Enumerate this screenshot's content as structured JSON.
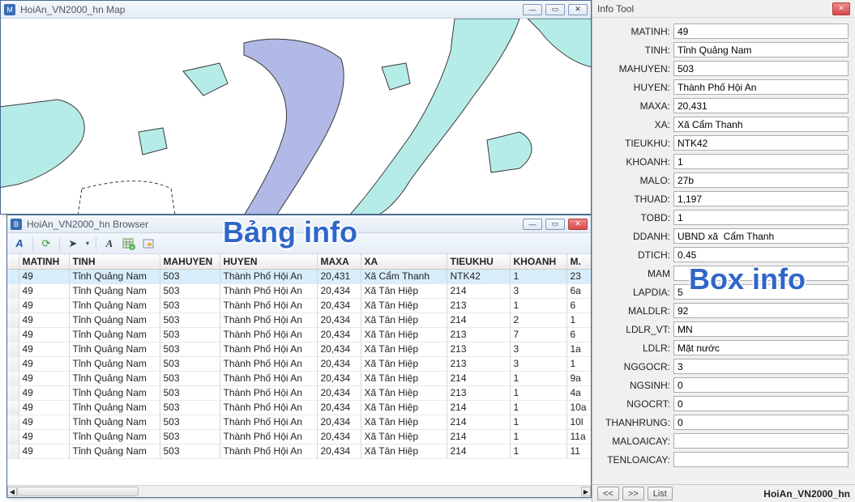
{
  "mapWindow": {
    "title": "HoiAn_VN2000_hn Map"
  },
  "browserWindow": {
    "title": "HoiAn_VN2000_hn Browser",
    "columns": [
      "MATINH",
      "TINH",
      "MAHUYEN",
      "HUYEN",
      "MAXA",
      "XA",
      "TIEUKHU",
      "KHOANH",
      "M."
    ],
    "rows": [
      {
        "sel": true,
        "MATINH": "49",
        "TINH": "Tỉnh Quảng Nam",
        "MAHUYEN": "503",
        "HUYEN": "Thành Phố Hội An",
        "MAXA": "20,431",
        "XA": "Xã Cẩm Thanh",
        "TIEUKHU": "NTK42",
        "KHOANH": "1",
        "M": "23"
      },
      {
        "MATINH": "49",
        "TINH": "Tỉnh Quảng Nam",
        "MAHUYEN": "503",
        "HUYEN": "Thành Phố Hội An",
        "MAXA": "20,434",
        "XA": "Xã Tân Hiệp",
        "TIEUKHU": "214",
        "KHOANH": "3",
        "M": "6a"
      },
      {
        "MATINH": "49",
        "TINH": "Tỉnh Quảng Nam",
        "MAHUYEN": "503",
        "HUYEN": "Thành Phố Hội An",
        "MAXA": "20,434",
        "XA": "Xã Tân Hiệp",
        "TIEUKHU": "213",
        "KHOANH": "1",
        "M": "6"
      },
      {
        "MATINH": "49",
        "TINH": "Tỉnh Quảng Nam",
        "MAHUYEN": "503",
        "HUYEN": "Thành Phố Hội An",
        "MAXA": "20,434",
        "XA": "Xã Tân Hiệp",
        "TIEUKHU": "214",
        "KHOANH": "2",
        "M": "1"
      },
      {
        "MATINH": "49",
        "TINH": "Tỉnh Quảng Nam",
        "MAHUYEN": "503",
        "HUYEN": "Thành Phố Hội An",
        "MAXA": "20,434",
        "XA": "Xã Tân Hiệp",
        "TIEUKHU": "213",
        "KHOANH": "7",
        "M": "6"
      },
      {
        "MATINH": "49",
        "TINH": "Tỉnh Quảng Nam",
        "MAHUYEN": "503",
        "HUYEN": "Thành Phố Hội An",
        "MAXA": "20,434",
        "XA": "Xã Tân Hiệp",
        "TIEUKHU": "213",
        "KHOANH": "3",
        "M": "1a"
      },
      {
        "MATINH": "49",
        "TINH": "Tỉnh Quảng Nam",
        "MAHUYEN": "503",
        "HUYEN": "Thành Phố Hội An",
        "MAXA": "20,434",
        "XA": "Xã Tân Hiệp",
        "TIEUKHU": "213",
        "KHOANH": "3",
        "M": "1"
      },
      {
        "MATINH": "49",
        "TINH": "Tỉnh Quảng Nam",
        "MAHUYEN": "503",
        "HUYEN": "Thành Phố Hội An",
        "MAXA": "20,434",
        "XA": "Xã Tân Hiệp",
        "TIEUKHU": "214",
        "KHOANH": "1",
        "M": "9a"
      },
      {
        "MATINH": "49",
        "TINH": "Tỉnh Quảng Nam",
        "MAHUYEN": "503",
        "HUYEN": "Thành Phố Hội An",
        "MAXA": "20,434",
        "XA": "Xã Tân Hiệp",
        "TIEUKHU": "213",
        "KHOANH": "1",
        "M": "4a"
      },
      {
        "MATINH": "49",
        "TINH": "Tỉnh Quảng Nam",
        "MAHUYEN": "503",
        "HUYEN": "Thành Phố Hội An",
        "MAXA": "20,434",
        "XA": "Xã Tân Hiệp",
        "TIEUKHU": "214",
        "KHOANH": "1",
        "M": "10a"
      },
      {
        "MATINH": "49",
        "TINH": "Tỉnh Quảng Nam",
        "MAHUYEN": "503",
        "HUYEN": "Thành Phố Hội An",
        "MAXA": "20,434",
        "XA": "Xã Tân Hiệp",
        "TIEUKHU": "214",
        "KHOANH": "1",
        "M": "10l"
      },
      {
        "MATINH": "49",
        "TINH": "Tỉnh Quảng Nam",
        "MAHUYEN": "503",
        "HUYEN": "Thành Phố Hội An",
        "MAXA": "20,434",
        "XA": "Xã Tân Hiệp",
        "TIEUKHU": "214",
        "KHOANH": "1",
        "M": "11a"
      },
      {
        "MATINH": "49",
        "TINH": "Tỉnh Quảng Nam",
        "MAHUYEN": "503",
        "HUYEN": "Thành Phố Hội An",
        "MAXA": "20,434",
        "XA": "Xã Tân Hiệp",
        "TIEUKHU": "214",
        "KHOANH": "1",
        "M": "11"
      }
    ]
  },
  "infoTool": {
    "title": "Info Tool",
    "listLabel": "List",
    "datasetLabel": "HoiAn_VN2000_hn",
    "fields": [
      {
        "label": "MATINH:",
        "value": "49"
      },
      {
        "label": "TINH:",
        "value": "Tỉnh Quảng Nam"
      },
      {
        "label": "MAHUYEN:",
        "value": "503"
      },
      {
        "label": "HUYEN:",
        "value": "Thành Phố Hội An"
      },
      {
        "label": "MAXA:",
        "value": "20,431"
      },
      {
        "label": "XA:",
        "value": "Xã Cẩm Thanh"
      },
      {
        "label": "TIEUKHU:",
        "value": "NTK42"
      },
      {
        "label": "KHOANH:",
        "value": "1"
      },
      {
        "label": "MALO:",
        "value": "27b"
      },
      {
        "label": "THUAD:",
        "value": "1,197"
      },
      {
        "label": "TOBD:",
        "value": "1"
      },
      {
        "label": "DDANH:",
        "value": "UBND xã  Cẩm Thanh"
      },
      {
        "label": "DTICH:",
        "value": "0.45"
      },
      {
        "label": "MAM",
        "value": ""
      },
      {
        "label": "LAPDIA:",
        "value": "5"
      },
      {
        "label": "MALDLR:",
        "value": "92"
      },
      {
        "label": "LDLR_VT:",
        "value": "MN"
      },
      {
        "label": "LDLR:",
        "value": "Mặt nước"
      },
      {
        "label": "NGGOCR:",
        "value": "3"
      },
      {
        "label": "NGSINH:",
        "value": "0"
      },
      {
        "label": "NGOCRT:",
        "value": "0"
      },
      {
        "label": "THANHRUNG:",
        "value": "0"
      },
      {
        "label": "MALOAICAY:",
        "value": ""
      },
      {
        "label": "TENLOAICAY:",
        "value": ""
      }
    ]
  },
  "overlays": {
    "bangInfo": "Bảng info",
    "boxInfo": "Box info"
  }
}
